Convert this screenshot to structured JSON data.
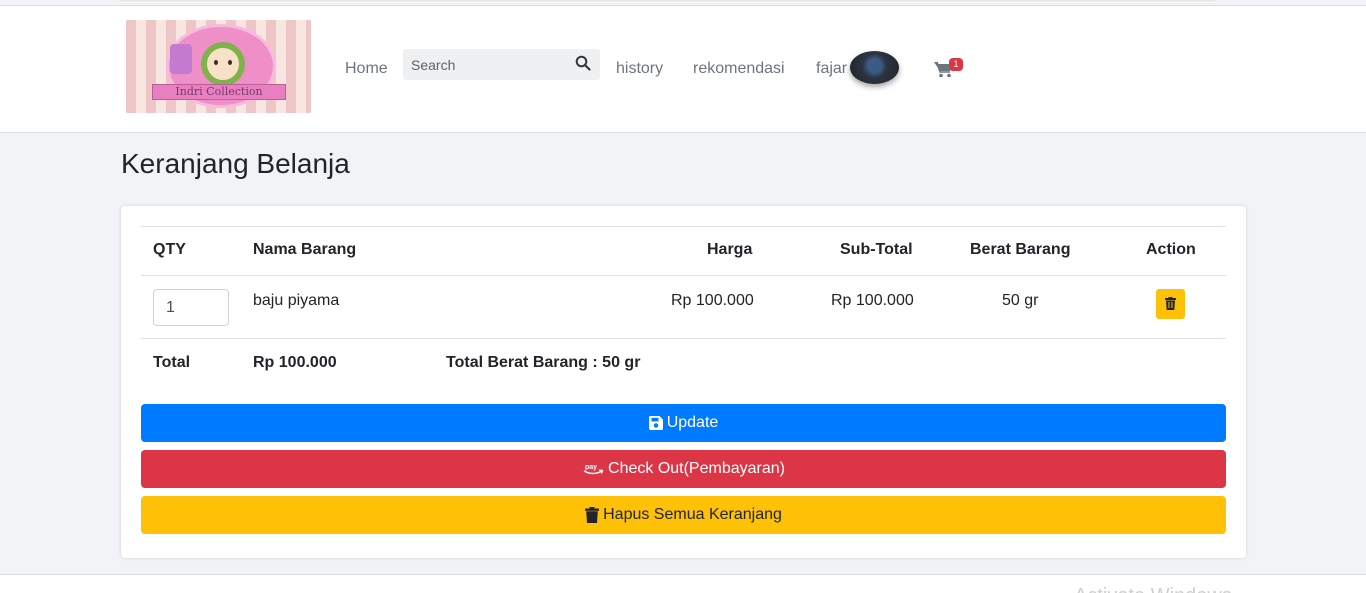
{
  "navbar": {
    "logo_text": "Indri Collection",
    "home": "Home",
    "search_placeholder": "Search",
    "history": "history",
    "rekomendasi": "rekomendasi",
    "user": "fajar",
    "cart_count": "1"
  },
  "page": {
    "title": "Keranjang Belanja"
  },
  "table": {
    "headers": [
      "QTY",
      "Nama Barang",
      "Harga",
      "Sub-Total",
      "Berat Barang",
      "Action"
    ],
    "rows": [
      {
        "qty": "1",
        "nama": "baju piyama",
        "harga": "Rp 100.000",
        "subtotal": "Rp 100.000",
        "berat": "50 gr"
      }
    ],
    "total_label": "Total",
    "total_value": "Rp 100.000",
    "total_berat": "Total Berat Barang : 50 gr"
  },
  "buttons": {
    "update": "Update",
    "checkout": "Check Out(Pembayaran)",
    "hapus": "Hapus Semua Keranjang"
  },
  "watermark": "Activate Windows",
  "colors": {
    "primary": "#007bff",
    "danger": "#dc3545",
    "warning": "#ffc107"
  }
}
